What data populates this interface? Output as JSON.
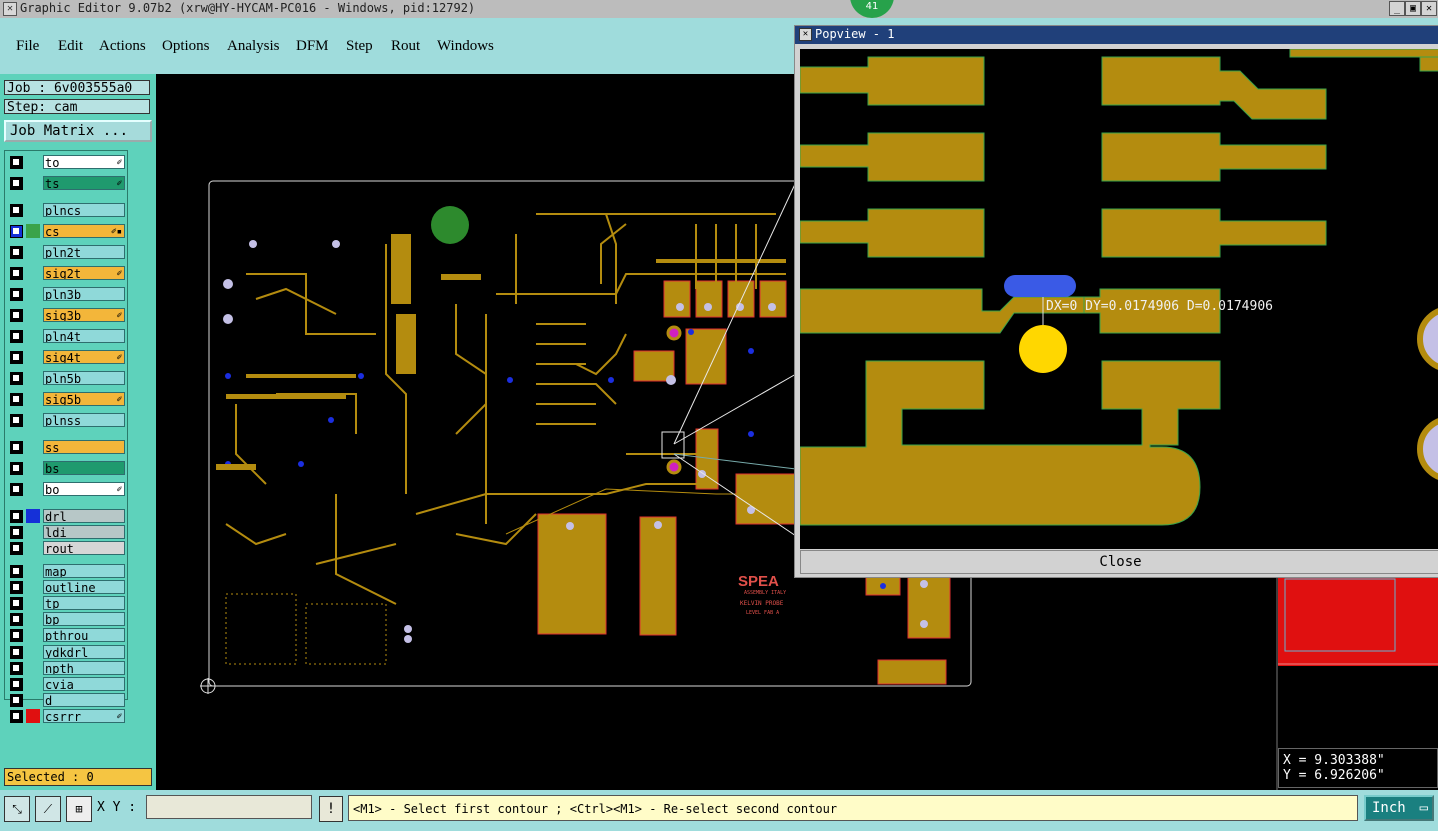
{
  "titlebar": {
    "title": "Graphic Editor 9.07b2 (xrw@HY-HYCAM-PC016 - Windows, pid:12792)",
    "badge": "41",
    "minimize": "_",
    "restore": "▣",
    "close": "✕"
  },
  "menu": [
    "File",
    "Edit",
    "Actions",
    "Options",
    "Analysis",
    "DFM",
    "Step",
    "Rout",
    "Windows"
  ],
  "job": "Job : 6v003555a0",
  "step": "Step: cam",
  "job_matrix": "Job Matrix ...",
  "layers": [
    {
      "name": "to",
      "color": "#ffffff",
      "swatch": "",
      "pen": "✐"
    },
    {
      "name": "ts",
      "color": "#1f9a6e",
      "swatch": "",
      "pen": "✐"
    },
    {
      "name": "plncs",
      "color": "#8fd9d9",
      "swatch": "",
      "pen": ""
    },
    {
      "name": "cs",
      "color": "#f3b63a",
      "swatch": "#3aa34a",
      "pen": "✐▪",
      "active": true
    },
    {
      "name": "pln2t",
      "color": "#8fd9d9",
      "swatch": "",
      "pen": ""
    },
    {
      "name": "sig2t",
      "color": "#f3b63a",
      "swatch": "",
      "pen": "✐"
    },
    {
      "name": "pln3b",
      "color": "#8fd9d9",
      "swatch": "",
      "pen": ""
    },
    {
      "name": "sig3b",
      "color": "#f3b63a",
      "swatch": "",
      "pen": "✐"
    },
    {
      "name": "pln4t",
      "color": "#8fd9d9",
      "swatch": "",
      "pen": ""
    },
    {
      "name": "sig4t",
      "color": "#f3b63a",
      "swatch": "",
      "pen": "✐"
    },
    {
      "name": "pln5b",
      "color": "#8fd9d9",
      "swatch": "",
      "pen": ""
    },
    {
      "name": "sig5b",
      "color": "#f3b63a",
      "swatch": "",
      "pen": "✐"
    },
    {
      "name": "plnss",
      "color": "#8fd9d9",
      "swatch": "",
      "pen": ""
    },
    {
      "name": "ss",
      "color": "#f3b63a",
      "swatch": "",
      "pen": ""
    },
    {
      "name": "bs",
      "color": "#1f9a6e",
      "swatch": "",
      "pen": ""
    },
    {
      "name": "bo",
      "color": "#ffffff",
      "swatch": "",
      "pen": "✐"
    },
    {
      "name": "drl",
      "color": "#b7c7c7",
      "swatch": "#1530d8",
      "pen": ""
    },
    {
      "name": "ldi",
      "color": "#b7c7c7",
      "swatch": "",
      "pen": ""
    },
    {
      "name": "rout",
      "color": "#d6d6d6",
      "swatch": "",
      "pen": ""
    },
    {
      "name": "map",
      "color": "#8fd9d9",
      "swatch": "",
      "pen": ""
    },
    {
      "name": "outline",
      "color": "#8fd9d9",
      "swatch": "",
      "pen": ""
    },
    {
      "name": "tp",
      "color": "#8fd9d9",
      "swatch": "",
      "pen": ""
    },
    {
      "name": "bp",
      "color": "#8fd9d9",
      "swatch": "",
      "pen": ""
    },
    {
      "name": "pthrou",
      "color": "#8fd9d9",
      "swatch": "",
      "pen": ""
    },
    {
      "name": "ydkdrl",
      "color": "#8fd9d9",
      "swatch": "",
      "pen": ""
    },
    {
      "name": "npth",
      "color": "#8fd9d9",
      "swatch": "",
      "pen": ""
    },
    {
      "name": "cvia",
      "color": "#8fd9d9",
      "swatch": "",
      "pen": ""
    },
    {
      "name": "d",
      "color": "#8fd9d9",
      "swatch": "",
      "pen": ""
    },
    {
      "name": "csrrr",
      "color": "#8fd9d9",
      "swatch": "#e01010",
      "pen": "✐"
    }
  ],
  "selected": "Selected : 0",
  "board_label_lines": [
    "SPEA",
    "ASSEMBLY ITALY",
    "KELVIN PROBE",
    "LEVEL FAB A"
  ],
  "popview": {
    "title": "Popview - 1",
    "measure": "DX=0 DY=0.0174906 D=0.0174906",
    "close": "Close"
  },
  "coords": {
    "x": "X = 9.303388\"",
    "y": "Y = 6.926206\""
  },
  "statusbar": {
    "xy_label": "X Y :",
    "xy_value": "",
    "bang": "!",
    "prompt": "<M1> - Select first contour ; <Ctrl><M1> - Re-select second contour",
    "units": "Inch"
  },
  "colors": {
    "copper": "#b48c0f",
    "canvas": "#000000",
    "panel": "#5ed2bb",
    "menu": "#9fdcdc",
    "pad_hole": "#c4c0e6",
    "via": "#1b2ee0"
  }
}
